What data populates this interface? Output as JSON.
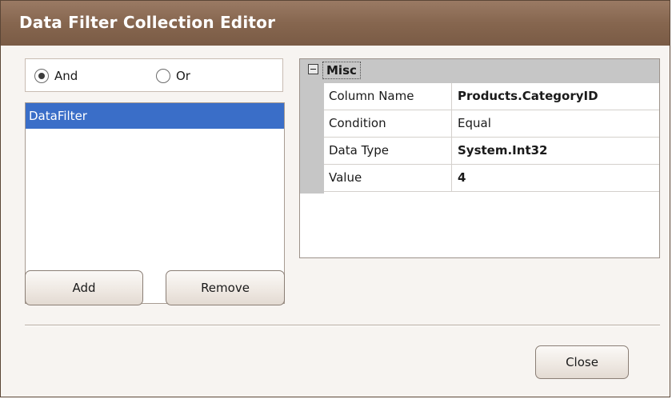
{
  "window": {
    "title": "Data Filter Collection Editor"
  },
  "logic": {
    "options": [
      {
        "label": "And",
        "selected": true
      },
      {
        "label": "Or",
        "selected": false
      }
    ]
  },
  "filters": {
    "items": [
      {
        "label": "DataFilter",
        "selected": true
      }
    ]
  },
  "buttons": {
    "add_label": "Add",
    "remove_label": "Remove",
    "close_label": "Close"
  },
  "property_grid": {
    "category": "Misc",
    "properties": [
      {
        "name": "Column Name",
        "value": "Products.CategoryID",
        "bold": true
      },
      {
        "name": "Condition",
        "value": "Equal",
        "bold": false
      },
      {
        "name": "Data Type",
        "value": "System.Int32",
        "bold": true
      },
      {
        "name": "Value",
        "value": "4",
        "bold": true
      }
    ]
  },
  "colors": {
    "title_bar": "#86664f",
    "selection": "#3a6ec8",
    "grid_gutter": "#c6c6c6"
  },
  "icons": {
    "collapse": "minus-box-icon"
  }
}
